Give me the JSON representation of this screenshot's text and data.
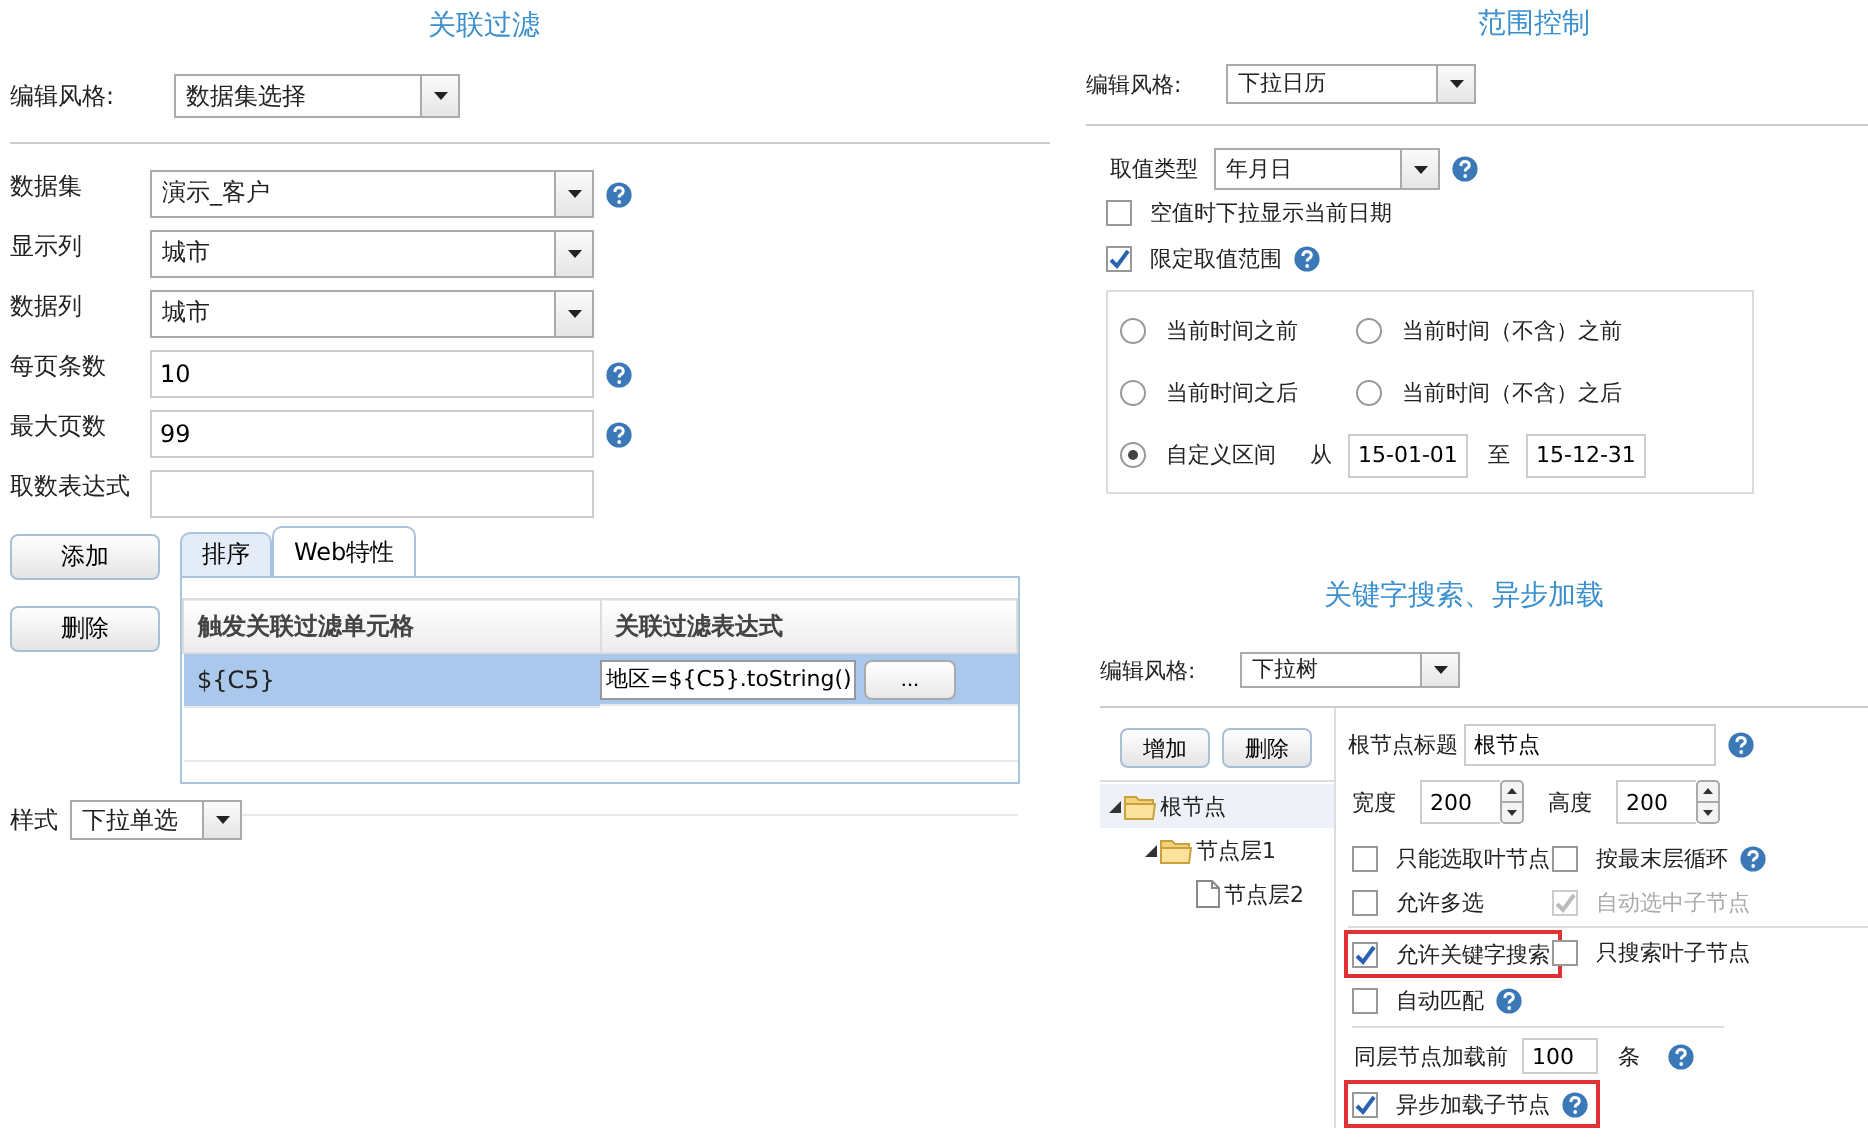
{
  "filter": {
    "title": "关联过滤",
    "style_label": "编辑风格:",
    "style_value": "数据集选择",
    "fields": [
      {
        "label": "数据集",
        "kind": "select",
        "value": "演示_客户",
        "help": true
      },
      {
        "label": "显示列",
        "kind": "select",
        "value": "城市",
        "help": false
      },
      {
        "label": "数据列",
        "kind": "select",
        "value": "城市",
        "help": false
      },
      {
        "label": "每页条数",
        "kind": "text",
        "value": "10",
        "help": true
      },
      {
        "label": "最大页数",
        "kind": "text",
        "value": "99",
        "help": true
      },
      {
        "label": "取数表达式",
        "kind": "text",
        "help": false
      }
    ],
    "buttons": [
      "添加",
      "删除"
    ],
    "tabs": [
      {
        "label": "排序",
        "selected": false
      },
      {
        "label": "Web特性",
        "selected": true
      }
    ],
    "table": {
      "columns": [
        "触发关联过滤单元格",
        "关联过滤表达式"
      ],
      "rows": [
        {
          "trigger": "${C5}",
          "expression": "地区=${C5}.toString()",
          "action": "...",
          "selected": true
        }
      ]
    },
    "display_label": "样式",
    "display_value": "下拉单选"
  },
  "range": {
    "title": "范围控制",
    "style_label": "编辑风格:",
    "style_value": "下拉日历",
    "type_label": "取值类型",
    "type_value": "年月日",
    "checkboxes": [
      {
        "label": "空值时下拉显示当前日期",
        "checked": false,
        "help": false
      },
      {
        "label": "限定取值范围",
        "checked": true,
        "help": true
      }
    ],
    "radios": [
      {
        "label": "当前时间之前",
        "selected": false
      },
      {
        "label": "当前时间（不含）之前",
        "selected": false
      },
      {
        "label": "当前时间之后",
        "selected": false
      },
      {
        "label": "当前时间（不含）之后",
        "selected": false
      },
      {
        "label": "自定义区间",
        "selected": true
      }
    ],
    "from_label": "从",
    "from": "15-01-01",
    "to_label": "至",
    "to": "15-12-31"
  },
  "tree": {
    "title": "关键字搜索、异步加载",
    "style_label": "编辑风格:",
    "style_value": "下拉树",
    "buttons": [
      "增加",
      "删除"
    ],
    "nodes": [
      {
        "label": "根节点",
        "expanded": true,
        "selected": true,
        "children": [
          {
            "label": "节点层1",
            "expanded": true,
            "selected": false,
            "children": [
              {
                "label": "节点层2",
                "selected": false
              }
            ]
          }
        ]
      }
    ],
    "root_label": "根节点标题",
    "root_value": "根节点",
    "width_label": "宽度",
    "width_value": "200",
    "height_label": "高度",
    "height_value": "200",
    "options": [
      {
        "label": "只能选取叶节点",
        "checked": false,
        "disabled": false,
        "help": false,
        "highlighted": false
      },
      {
        "label": "按最末层循环",
        "checked": false,
        "disabled": false,
        "help": true,
        "highlighted": false
      },
      {
        "label": "允许多选",
        "checked": false,
        "disabled": false,
        "help": false,
        "highlighted": false
      },
      {
        "label": "自动选中子节点",
        "checked": true,
        "disabled": true,
        "help": false,
        "highlighted": false
      },
      {
        "label": "允许关键字搜索",
        "checked": true,
        "disabled": false,
        "help": false,
        "highlighted": true
      },
      {
        "label": "只搜索叶子节点",
        "checked": false,
        "disabled": false,
        "help": false,
        "highlighted": false
      },
      {
        "label": "自动匹配",
        "checked": false,
        "disabled": false,
        "help": true,
        "highlighted": false
      }
    ],
    "load_label": "同层节点加载前",
    "load_value": "100",
    "load_unit": "条",
    "async": {
      "label": "异步加载子节点",
      "checked": true,
      "help": true,
      "highlighted": true
    }
  }
}
